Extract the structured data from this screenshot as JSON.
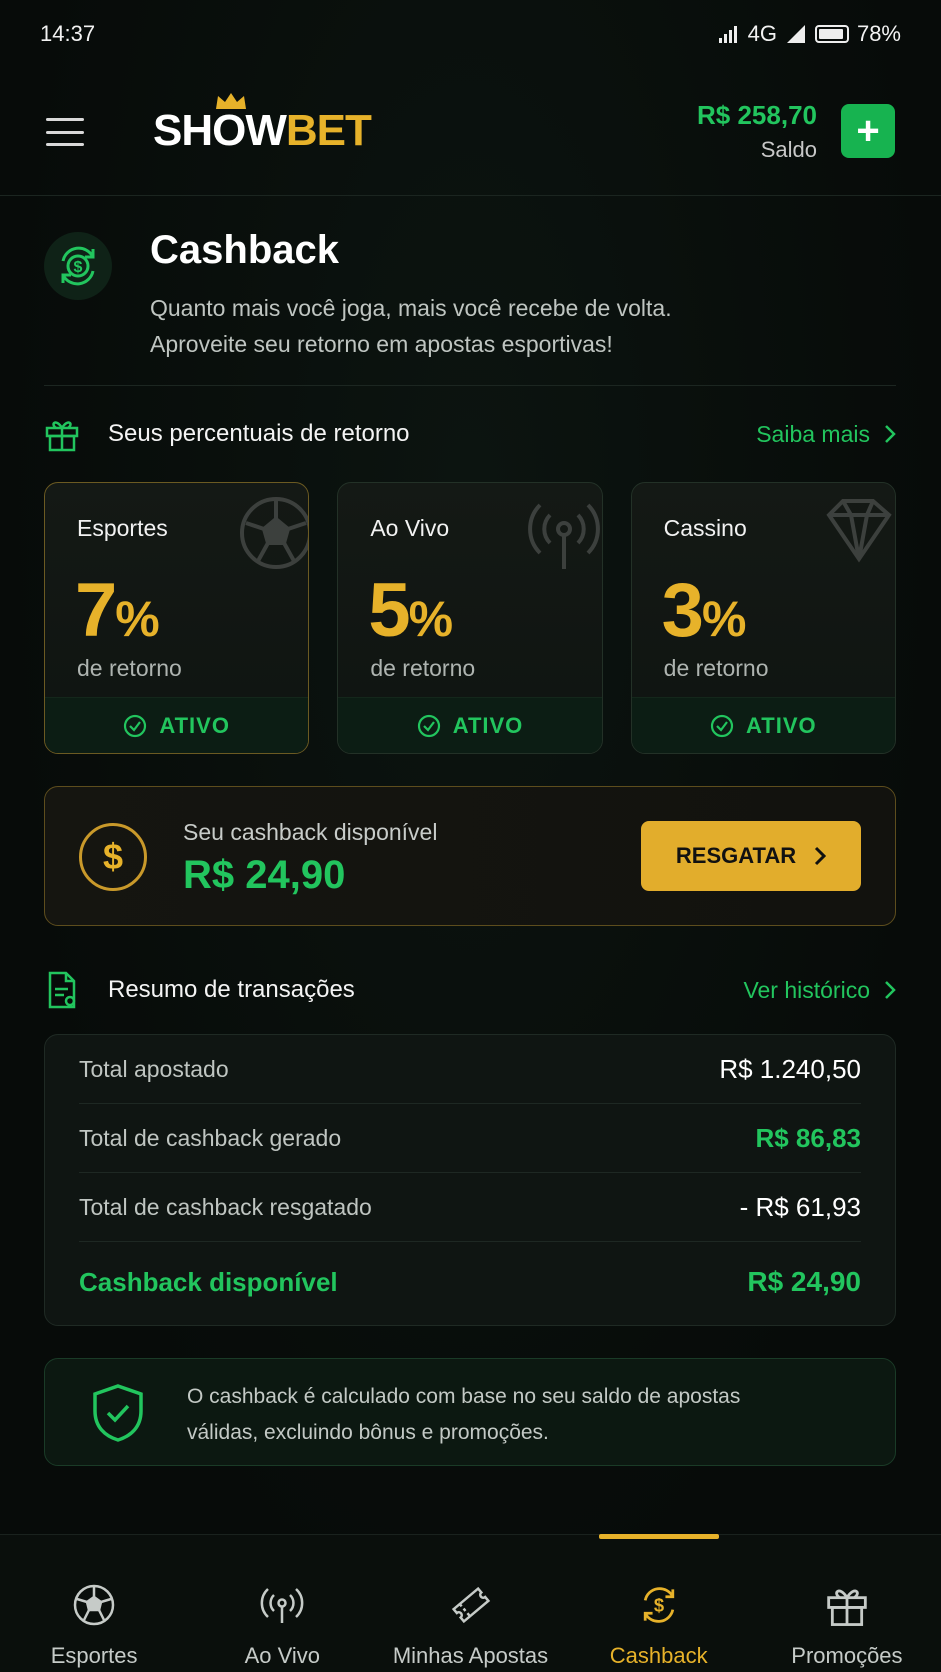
{
  "status_bar": {
    "time": "14:37",
    "network": "4G",
    "battery": "78%"
  },
  "header": {
    "logo_white": "SHOW",
    "logo_yellow": "BET",
    "balance": "R$ 258,70",
    "balance_label": "Saldo",
    "add_label": "+"
  },
  "cashback": {
    "title": "Cashback",
    "desc_line1": "Quanto mais você joga, mais você recebe de volta.",
    "desc_line2": "Aproveite seu retorno em apostas esportivas!"
  },
  "percents": {
    "title": "Seus percentuais de retorno",
    "link": "Saiba mais",
    "cards": [
      {
        "name": "Esportes",
        "value": "7",
        "sign": "%",
        "sub": "de retorno",
        "status": "ATIVO",
        "icon": "soccer-ball-icon"
      },
      {
        "name": "Ao Vivo",
        "value": "5",
        "sign": "%",
        "sub": "de retorno",
        "status": "ATIVO",
        "icon": "broadcast-icon"
      },
      {
        "name": "Cassino",
        "value": "3",
        "sign": "%",
        "sub": "de retorno",
        "status": "ATIVO",
        "icon": "diamond-icon"
      }
    ]
  },
  "available": {
    "label": "Seu cashback disponível",
    "amount": "R$ 24,90",
    "button": "RESGATAR",
    "coin_symbol": "$"
  },
  "transactions": {
    "title": "Resumo de transações",
    "link": "Ver histórico",
    "rows": [
      {
        "label": "Total apostado",
        "value": "R$ 1.240,50"
      },
      {
        "label": "Total de cashback gerado",
        "value": "R$ 86,83"
      },
      {
        "label": "Total de cashback resgatado",
        "value": "- R$ 61,93"
      },
      {
        "label": "Cashback disponível",
        "value": "R$ 24,90"
      }
    ]
  },
  "info": {
    "line1": "O cashback é calculado com base no seu saldo de apostas",
    "line2": "válidas, excluindo bônus e promoções."
  },
  "bottom_nav": {
    "items": [
      {
        "label": "Esportes",
        "icon": "soccer-ball-icon"
      },
      {
        "label": "Ao Vivo",
        "icon": "broadcast-icon"
      },
      {
        "label": "Minhas Apostas",
        "icon": "ticket-icon"
      },
      {
        "label": "Cashback",
        "icon": "cashback-icon",
        "active": true
      },
      {
        "label": "Promoções",
        "icon": "gift-icon"
      }
    ]
  },
  "colors": {
    "green": "#22c55e",
    "gold": "#e7b22a",
    "background": "#070b09"
  }
}
